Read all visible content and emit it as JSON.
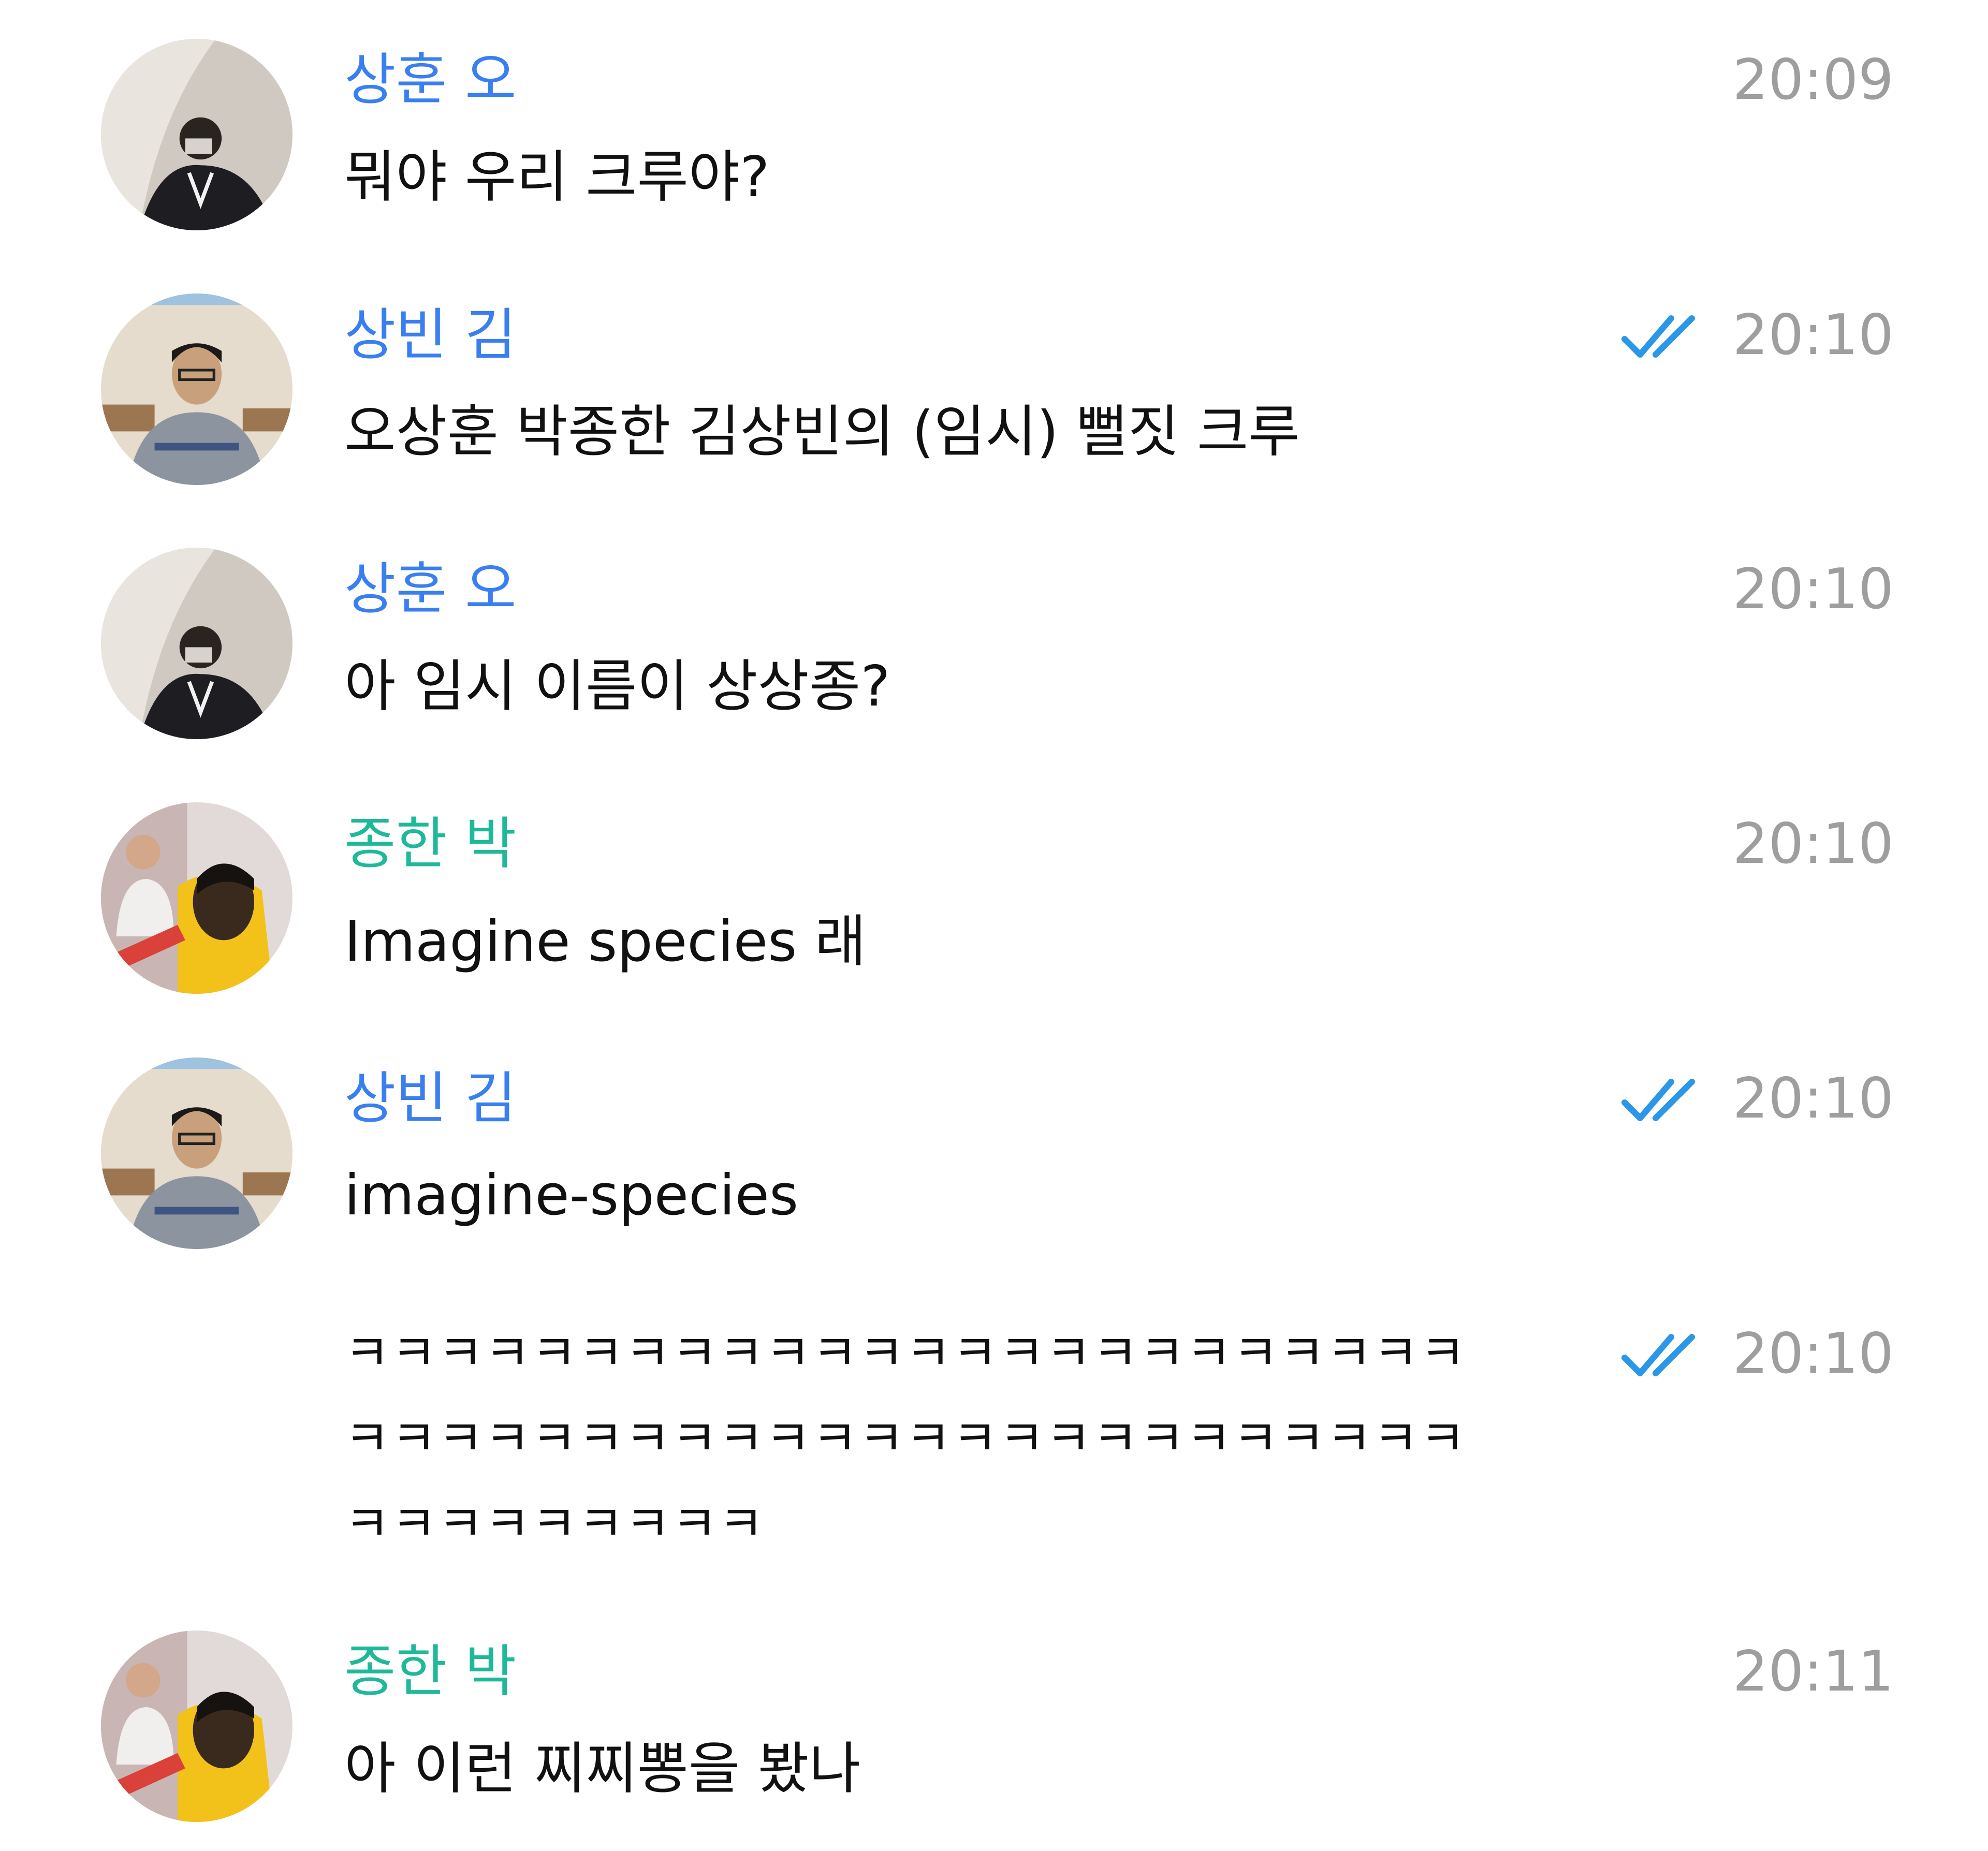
{
  "colors": {
    "name_blue": "#3a7ff0",
    "name_green": "#1fb99a",
    "check_blue": "#2a97e8",
    "time_gray": "#9e9e9e",
    "text": "#111111"
  },
  "icons": {
    "read_receipt": "double-check-icon"
  },
  "messages": [
    {
      "sender": "상훈 오",
      "text": "뭐야 우리 크루야?",
      "time": "20:09",
      "read": false
    },
    {
      "sender": "상빈 김",
      "text": "오상훈 박종한 김상빈의 (임시) 뻘짓 크루",
      "time": "20:10",
      "read": true
    },
    {
      "sender": "상훈 오",
      "text": "아 임시 이름이 상상종?",
      "time": "20:10",
      "read": false
    },
    {
      "sender": "종한 박",
      "text": "Imagine species 래",
      "time": "20:10",
      "read": false
    },
    {
      "sender": "상빈 김",
      "text": "imagine-species",
      "time": "20:10",
      "read": true
    },
    {
      "sender": "",
      "text": "ㅋㅋㅋㅋㅋㅋㅋㅋㅋㅋㅋㅋㅋㅋㅋㅋㅋㅋㅋㅋㅋㅋㅋㅋㅋㅋㅋㅋㅋㅋㅋㅋㅋㅋㅋㅋㅋㅋㅋㅋㅋㅋㅋㅋㅋㅋㅋㅋㅋㅋㅋㅋㅋㅋㅋㅋㅋ",
      "time": "20:10",
      "read": true
    },
    {
      "sender": "종한 박",
      "text": "아 이런 찌찌뽕을 봤나",
      "time": "20:11",
      "read": false
    }
  ]
}
